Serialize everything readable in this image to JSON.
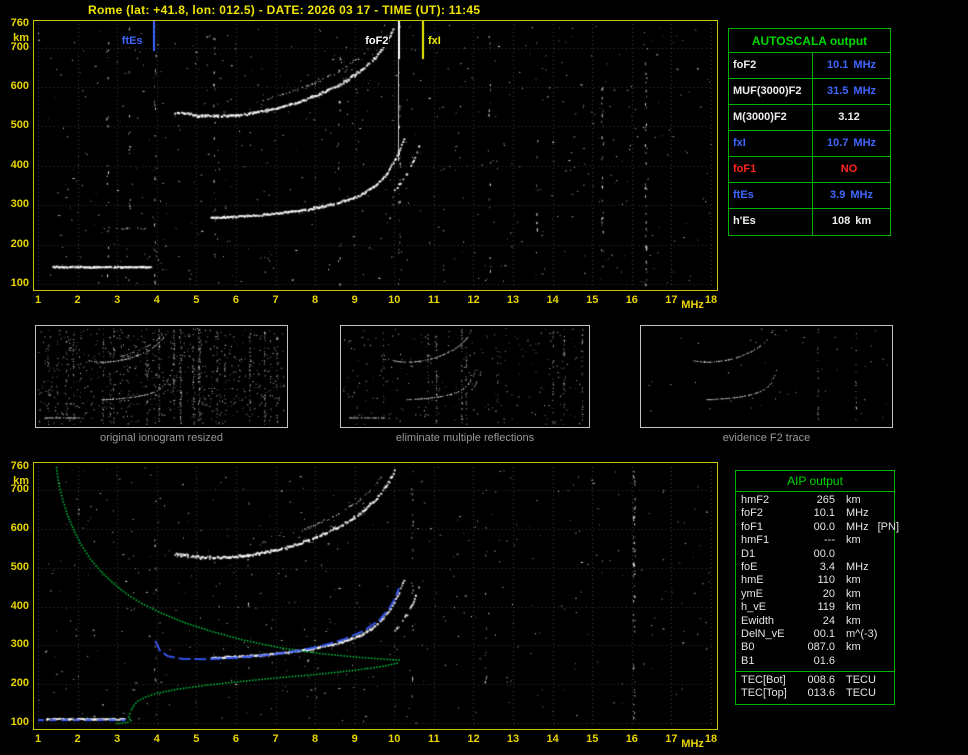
{
  "title": "Rome (lat: +41.8, lon: 012.5) - DATE: 2026 03 17 - TIME (UT): 11:45",
  "colors": {
    "axis_yellow": "#e8d400",
    "grid_gray": "#3a3a3a",
    "trace_white": "#ffffff",
    "profile_green": "#00cc44",
    "fit_blue": "#3c5cff",
    "table_green": "#00b400",
    "value_blue": "#3f66ff",
    "alert_red": "#ff2424",
    "caption_gray": "#9a9a9a"
  },
  "axes": {
    "freq_ticks": [
      1,
      2,
      3,
      4,
      5,
      6,
      7,
      8,
      9,
      10,
      11,
      12,
      13,
      14,
      15,
      16,
      17,
      18
    ],
    "freq_unit": "MHz",
    "height_ticks": [
      760,
      700,
      600,
      500,
      400,
      300,
      200,
      100
    ],
    "height_unit": "km",
    "fmin": 1,
    "fmax": 18,
    "hmin": 100,
    "hmax": 760
  },
  "top_plot": {
    "markers": [
      {
        "label": "ftEs",
        "f": 3.9,
        "color": "#3f66ff",
        "len": 30,
        "label_dx": -32
      },
      {
        "label": "foF2",
        "f": 10.1,
        "color": "#ffffff",
        "len": 140,
        "label_dx": -34
      },
      {
        "label": "fxI",
        "f": 10.7,
        "color": "#f0f000",
        "len": 38,
        "label_dx": 5
      }
    ],
    "noise": 520,
    "bands": [
      {
        "f": 2.75,
        "count": 16
      },
      {
        "f": 3.3,
        "count": 12
      },
      {
        "f": 3.95,
        "count": 24
      },
      {
        "f": 5.45,
        "count": 20
      },
      {
        "f": 8.6,
        "count": 14
      },
      {
        "f": 10.12,
        "count": 28
      },
      {
        "f": 12.4,
        "count": 16
      },
      {
        "f": 13.6,
        "count": 10
      },
      {
        "f": 15.25,
        "count": 26
      },
      {
        "f": 16.35,
        "count": 38
      }
    ],
    "traces": [
      {
        "name": "Es",
        "points": [
          [
            1.35,
            145
          ],
          [
            3.85,
            145
          ]
        ],
        "size": 2,
        "density": 0.95,
        "jitter": 2
      },
      {
        "name": "Es-second-hop",
        "points": [
          [
            2.6,
            242
          ],
          [
            3.75,
            242
          ]
        ],
        "size": 1,
        "density": 0.3,
        "jitter": 3
      },
      {
        "name": "F2-ordinary",
        "points": [
          [
            5.35,
            270
          ],
          [
            6.2,
            274
          ],
          [
            7.0,
            281
          ],
          [
            7.8,
            291
          ],
          [
            8.5,
            306
          ],
          [
            9.1,
            326
          ],
          [
            9.5,
            351
          ],
          [
            9.8,
            383
          ],
          [
            10.0,
            416
          ],
          [
            10.15,
            449
          ],
          [
            10.25,
            478
          ]
        ],
        "size": 2,
        "density": 0.92,
        "jitter": 3
      },
      {
        "name": "F2-extraordinary",
        "points": [
          [
            10.0,
            340
          ],
          [
            10.3,
            381
          ],
          [
            10.5,
            421
          ],
          [
            10.62,
            456
          ],
          [
            10.7,
            486
          ]
        ],
        "size": 2,
        "density": 0.55,
        "jitter": 3
      },
      {
        "name": "F2-second-hop",
        "points": [
          [
            4.45,
            538
          ],
          [
            5.0,
            530
          ],
          [
            5.6,
            528
          ],
          [
            6.2,
            533
          ],
          [
            6.8,
            543
          ],
          [
            7.4,
            558
          ],
          [
            8.0,
            580
          ],
          [
            8.6,
            608
          ],
          [
            9.1,
            640
          ],
          [
            9.5,
            676
          ],
          [
            9.8,
            715
          ],
          [
            10.0,
            756
          ]
        ],
        "size": 2,
        "density": 0.9,
        "jitter": 4
      },
      {
        "name": "F2-second-hop-echo",
        "points": [
          [
            6.6,
            565
          ],
          [
            7.3,
            586
          ],
          [
            8.0,
            612
          ],
          [
            8.6,
            642
          ],
          [
            9.1,
            675
          ],
          [
            9.5,
            712
          ],
          [
            9.75,
            748
          ]
        ],
        "size": 1,
        "density": 0.4,
        "jitter": 4
      }
    ]
  },
  "bottom_plot": {
    "noise": 420,
    "bands": [
      {
        "f": 3.95,
        "count": 10
      },
      {
        "f": 6.3,
        "count": 8
      },
      {
        "f": 10.45,
        "count": 20
      },
      {
        "f": 12.3,
        "count": 10
      },
      {
        "f": 16.05,
        "count": 55
      }
    ],
    "traces": [
      {
        "name": "Es",
        "points": [
          [
            1.2,
            112
          ],
          [
            3.2,
            112
          ]
        ],
        "size": 2,
        "density": 0.9,
        "jitter": 2
      },
      {
        "name": "F2-ordinary",
        "points": [
          [
            5.35,
            270
          ],
          [
            6.2,
            274
          ],
          [
            7.0,
            281
          ],
          [
            7.8,
            291
          ],
          [
            8.5,
            306
          ],
          [
            9.1,
            326
          ],
          [
            9.5,
            351
          ],
          [
            9.8,
            383
          ],
          [
            10.0,
            416
          ],
          [
            10.15,
            449
          ],
          [
            10.25,
            478
          ]
        ],
        "size": 2,
        "density": 0.92,
        "jitter": 3
      },
      {
        "name": "F2-extraordinary",
        "points": [
          [
            10.0,
            340
          ],
          [
            10.3,
            381
          ],
          [
            10.5,
            421
          ],
          [
            10.62,
            456
          ],
          [
            10.7,
            486
          ]
        ],
        "size": 2,
        "density": 0.5,
        "jitter": 3
      },
      {
        "name": "F2-second-hop",
        "points": [
          [
            4.45,
            538
          ],
          [
            5.0,
            530
          ],
          [
            5.6,
            528
          ],
          [
            6.2,
            533
          ],
          [
            6.8,
            543
          ],
          [
            7.4,
            558
          ],
          [
            8.0,
            580
          ],
          [
            8.6,
            608
          ],
          [
            9.1,
            640
          ],
          [
            9.5,
            676
          ],
          [
            9.8,
            715
          ],
          [
            10.0,
            756
          ]
        ],
        "size": 2,
        "density": 0.88,
        "jitter": 4
      },
      {
        "name": "F2-second-hop-echo",
        "points": [
          [
            6.6,
            565
          ],
          [
            7.3,
            586
          ],
          [
            8.0,
            612
          ],
          [
            8.6,
            642
          ],
          [
            9.1,
            675
          ],
          [
            9.5,
            712
          ],
          [
            9.75,
            748
          ]
        ],
        "size": 1,
        "density": 0.35,
        "jitter": 4
      }
    ],
    "fitted_trace": {
      "points": [
        [
          3.95,
          312
        ],
        [
          4.05,
          290
        ],
        [
          4.25,
          275
        ],
        [
          4.6,
          268
        ],
        [
          5.2,
          267
        ],
        [
          6.0,
          271
        ],
        [
          6.8,
          278
        ],
        [
          7.5,
          288
        ],
        [
          8.1,
          300
        ],
        [
          8.7,
          318
        ],
        [
          9.2,
          340
        ],
        [
          9.6,
          368
        ],
        [
          9.85,
          398
        ],
        [
          10.0,
          425
        ],
        [
          10.1,
          452
        ]
      ]
    },
    "es_fit": {
      "points": [
        [
          1.0,
          110
        ],
        [
          3.2,
          110
        ]
      ]
    },
    "profile": {
      "points": [
        [
          1.45,
          760
        ],
        [
          1.5,
          720
        ],
        [
          1.6,
          680
        ],
        [
          1.72,
          640
        ],
        [
          1.88,
          600
        ],
        [
          2.08,
          560
        ],
        [
          2.3,
          525
        ],
        [
          2.55,
          495
        ],
        [
          2.85,
          465
        ],
        [
          3.2,
          436
        ],
        [
          3.6,
          410
        ],
        [
          4.1,
          385
        ],
        [
          4.7,
          360
        ],
        [
          5.4,
          337
        ],
        [
          6.2,
          315
        ],
        [
          7.1,
          296
        ],
        [
          8.1,
          281
        ],
        [
          9.1,
          271
        ],
        [
          9.8,
          266
        ],
        [
          10.1,
          264
        ],
        [
          10.05,
          256
        ],
        [
          9.7,
          248
        ],
        [
          9.0,
          238
        ],
        [
          8.1,
          228
        ],
        [
          7.1,
          219
        ],
        [
          6.1,
          209
        ],
        [
          5.2,
          199
        ],
        [
          4.5,
          189
        ],
        [
          4.0,
          179
        ],
        [
          3.7,
          169
        ],
        [
          3.5,
          158
        ],
        [
          3.4,
          147
        ],
        [
          3.34,
          136
        ],
        [
          3.3,
          126
        ],
        [
          3.27,
          118
        ],
        [
          3.3,
          112
        ],
        [
          3.33,
          108
        ],
        [
          3.25,
          104
        ],
        [
          3.05,
          101
        ],
        [
          2.9,
          100
        ]
      ]
    }
  },
  "thumbnails": [
    {
      "caption": "original ionogram resized",
      "noise": 700,
      "stripes": 22,
      "trace_indices": [
        0,
        1,
        2,
        3,
        4,
        5
      ]
    },
    {
      "caption": "eliminate multiple reflections",
      "noise": 240,
      "stripes": 9,
      "trace_indices": [
        0,
        2,
        3,
        4
      ]
    },
    {
      "caption": "evidence F2 trace",
      "noise": 45,
      "stripes": 2,
      "trace_indices": [
        2,
        4
      ]
    }
  ],
  "autoscala_table": {
    "title": "AUTOSCALA output",
    "rows": [
      {
        "label": "foF2",
        "value": "10.1",
        "unit": "MHz",
        "label_color": "white",
        "value_color": "blue"
      },
      {
        "label": "MUF(3000)F2",
        "value": "31.5",
        "unit": "MHz",
        "label_color": "white",
        "value_color": "blue"
      },
      {
        "label": "M(3000)F2",
        "value": "3.12",
        "unit": "",
        "label_color": "white",
        "value_color": "white"
      },
      {
        "label": "fxI",
        "value": "10.7",
        "unit": "MHz",
        "label_color": "blue",
        "value_color": "blue"
      },
      {
        "label": "foF1",
        "value": "NO",
        "unit": "",
        "label_color": "red",
        "value_color": "red"
      },
      {
        "label": "ftEs",
        "value": "3.9",
        "unit": "MHz",
        "label_color": "blue",
        "value_color": "blue"
      },
      {
        "label": "h'Es",
        "value": "108",
        "unit": "km",
        "label_color": "white",
        "value_color": "white"
      }
    ]
  },
  "aip_table": {
    "title": "AIP output",
    "rows": [
      {
        "label": "hmF2",
        "value": "265",
        "unit": "km",
        "suffix": ""
      },
      {
        "label": "foF2",
        "value": "10.1",
        "unit": "MHz",
        "suffix": ""
      },
      {
        "label": "foF1",
        "value": "00.0",
        "unit": "MHz",
        "suffix": "[PN]"
      },
      {
        "label": "hmF1",
        "value": "---",
        "unit": "km",
        "suffix": ""
      },
      {
        "label": "D1",
        "value": "00.0",
        "unit": "",
        "suffix": ""
      },
      {
        "label": "foE",
        "value": "3.4",
        "unit": "MHz",
        "suffix": ""
      },
      {
        "label": "hmE",
        "value": "110",
        "unit": "km",
        "suffix": ""
      },
      {
        "label": "ymE",
        "value": "20",
        "unit": "km",
        "suffix": ""
      },
      {
        "label": "h_vE",
        "value": "119",
        "unit": "km",
        "suffix": ""
      },
      {
        "label": "Ewidth",
        "value": "24",
        "unit": "km",
        "suffix": ""
      },
      {
        "label": "DelN_vE",
        "value": "00.1",
        "unit": "m^(-3)",
        "suffix": ""
      },
      {
        "label": "B0",
        "value": "087.0",
        "unit": "km",
        "suffix": ""
      },
      {
        "label": "B1",
        "value": "01.6",
        "unit": "",
        "suffix": ""
      }
    ],
    "footer_rows": [
      {
        "label": "TEC[Bot]",
        "value": "008.6",
        "unit": "TECU",
        "suffix": ""
      },
      {
        "label": "TEC[Top]",
        "value": "013.6",
        "unit": "TECU",
        "suffix": ""
      }
    ]
  }
}
